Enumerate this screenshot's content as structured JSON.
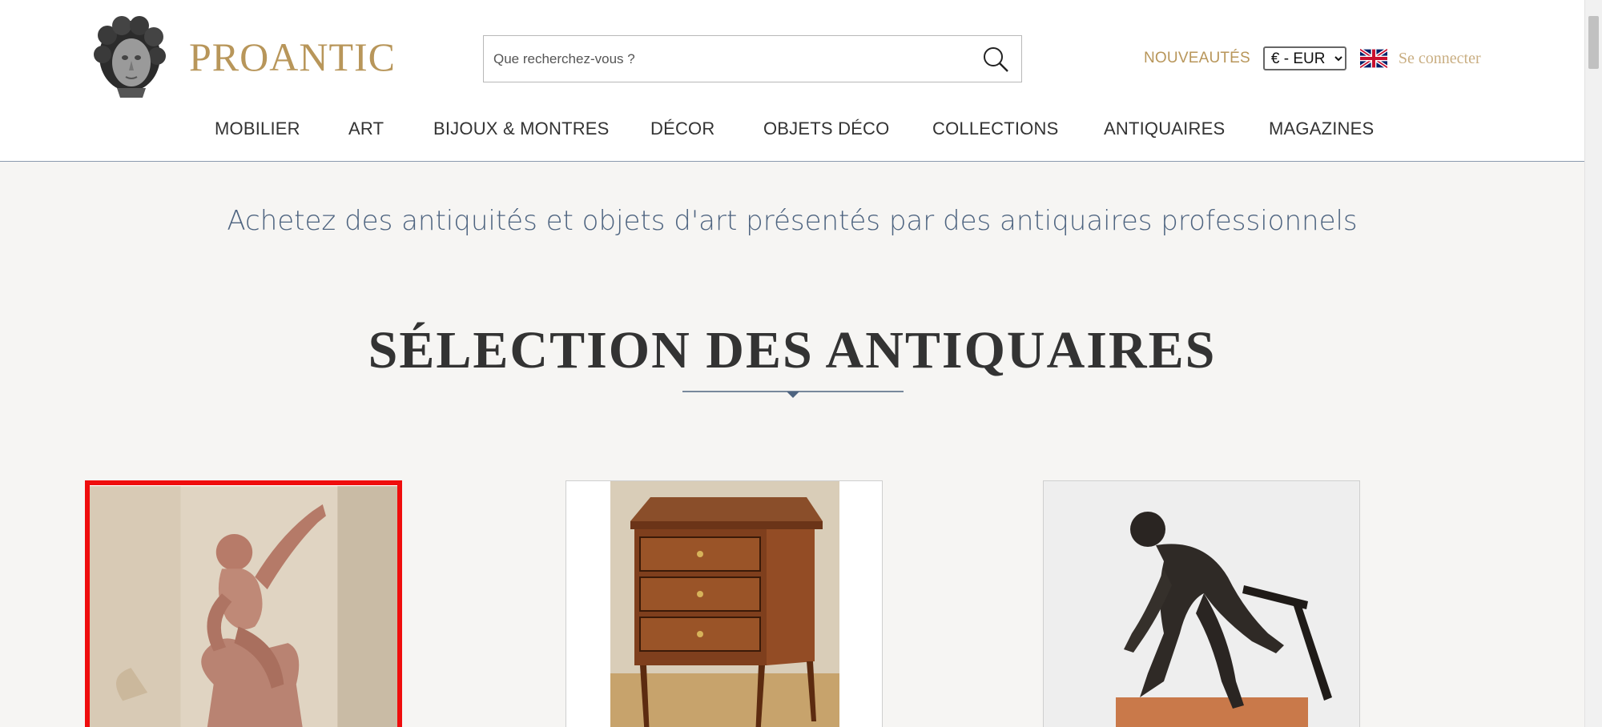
{
  "header": {
    "logo_text": "PROANTIC",
    "search": {
      "placeholder": "Que recherchez-vous ?"
    },
    "news_label": "NOUVEAUTÉS",
    "currency": {
      "selected": "€ - EUR"
    },
    "login_label": "Se connecter",
    "nav": [
      "MOBILIER",
      "ART",
      "BIJOUX & MONTRES",
      "DÉCOR",
      "OBJETS DÉCO",
      "COLLECTIONS",
      "ANTIQUAIRES",
      "MAGAZINES"
    ]
  },
  "main": {
    "tagline": "Achetez des antiquités et objets d'art présentés par des antiquaires professionnels",
    "section_title": "SÉLECTION DES ANTIQUAIRES"
  },
  "colors": {
    "brand_gold": "#b8965a",
    "nav_text": "#333333",
    "tagline": "#4e6480",
    "selected_border": "#ef0d0d",
    "background": "#f6f5f3"
  },
  "icons": {
    "search": "search-icon",
    "flag": "uk-flag-icon",
    "logo": "bust-head-logo"
  }
}
